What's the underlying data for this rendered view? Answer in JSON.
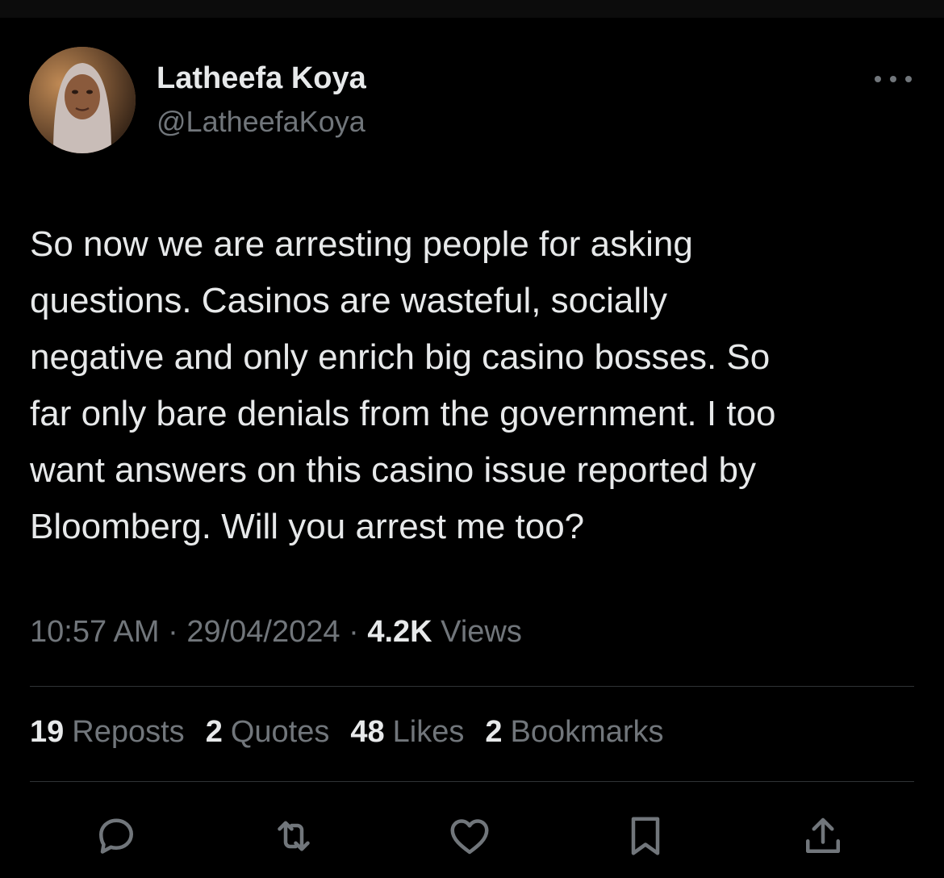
{
  "author": {
    "display_name": "Latheefa Koya",
    "handle": "@LatheefaKoya"
  },
  "tweet": {
    "lines": [
      "So now we are arresting people for asking",
      "questions. Casinos are wasteful, socially",
      "negative and only enrich big casino bosses. So",
      "far only bare denials from the government. I too",
      "want answers on this casino issue reported by",
      "Bloomberg. Will you arrest me too?"
    ]
  },
  "meta": {
    "time": "10:57 AM",
    "separator": "·",
    "date": "29/04/2024",
    "views_count": "4.2K",
    "views_label": "Views"
  },
  "stats": [
    {
      "count": "19",
      "label": "Reposts"
    },
    {
      "count": "2",
      "label": "Quotes"
    },
    {
      "count": "48",
      "label": "Likes"
    },
    {
      "count": "2",
      "label": "Bookmarks"
    }
  ],
  "actions": [
    {
      "icon": "reply-icon"
    },
    {
      "icon": "repost-icon"
    },
    {
      "icon": "like-icon"
    },
    {
      "icon": "bookmark-icon"
    },
    {
      "icon": "share-icon"
    }
  ],
  "colors": {
    "background": "#000000",
    "primary_text": "#e7e9ea",
    "secondary_text": "#71767b",
    "divider": "#2f3336"
  }
}
